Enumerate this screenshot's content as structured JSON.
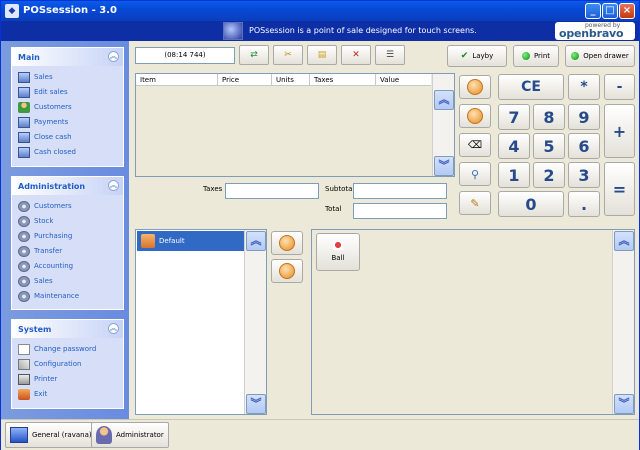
{
  "window": {
    "title": "POSsession - 3.0"
  },
  "header": {
    "tagline": "POSsession is a point of sale designed for touch screens.",
    "brand_small": "powered by",
    "brand_name": "openbravo"
  },
  "sidebar": {
    "main": {
      "title": "Main",
      "items": [
        "Sales",
        "Edit sales",
        "Customers",
        "Payments",
        "Close cash",
        "Cash closed"
      ]
    },
    "administration": {
      "title": "Administration",
      "items": [
        "Customers",
        "Stock",
        "Purchasing",
        "Transfer",
        "Accounting",
        "Sales",
        "Maintenance"
      ]
    },
    "system": {
      "title": "System",
      "items": [
        "Change password",
        "Configuration",
        "Printer",
        "Exit"
      ]
    }
  },
  "toolbar": {
    "clock": "(08:14 744)"
  },
  "actions": {
    "layby": "Layby",
    "print": "Print",
    "open_drawer": "Open drawer"
  },
  "ticket": {
    "columns": [
      "Item",
      "Price",
      "Units",
      "Taxes",
      "Value"
    ]
  },
  "totals": {
    "taxes_label": "Taxes",
    "subtotal_label": "Subtotal",
    "total_label": "Total"
  },
  "numpad": {
    "ce": "CE",
    "multiply": "*",
    "minus": "-",
    "plus": "+",
    "equals": "=",
    "dot": ".",
    "digits": [
      "7",
      "8",
      "9",
      "4",
      "5",
      "6",
      "1",
      "2",
      "3",
      "0"
    ]
  },
  "categories": {
    "selected": "Default"
  },
  "products": [
    {
      "name": "Ball"
    }
  ],
  "footer": {
    "location": "General (ravana)",
    "user": "Administrator"
  }
}
